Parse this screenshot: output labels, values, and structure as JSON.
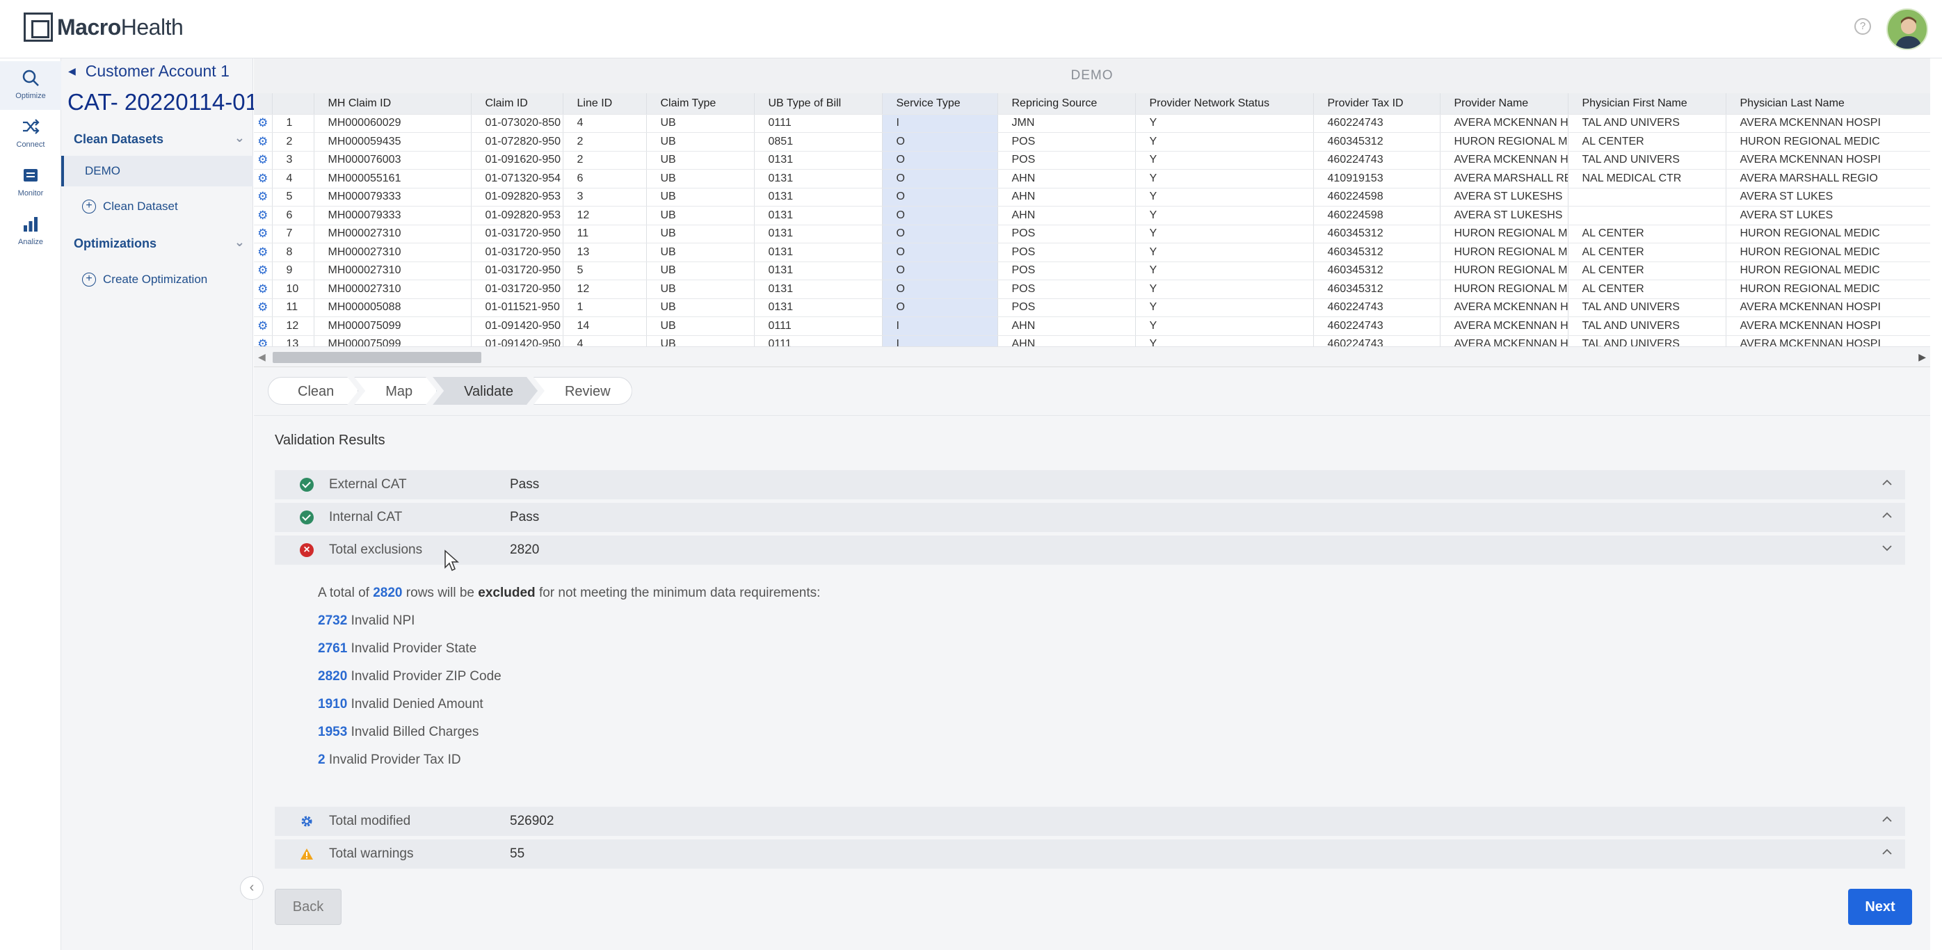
{
  "header": {
    "logo_bold": "Macro",
    "logo_rest": "Health",
    "help_icon": "?"
  },
  "rail": [
    {
      "label": "Optimize",
      "icon": "search-icon",
      "active": true
    },
    {
      "label": "Connect",
      "icon": "shuffle-icon"
    },
    {
      "label": "Monitor",
      "icon": "list-icon"
    },
    {
      "label": "Analize",
      "icon": "bar-chart-icon"
    }
  ],
  "left_panel": {
    "account": "Customer Account 1",
    "cat_title": "CAT- 20220114-01",
    "clean_datasets": "Clean Datasets",
    "demo_item": "DEMO",
    "add_clean_dataset": "Clean Dataset",
    "optimizations": "Optimizations",
    "add_optimization": "Create Optimization"
  },
  "grid": {
    "caption": "DEMO",
    "columns": [
      "MH Claim ID",
      "Claim ID",
      "Line ID",
      "Claim Type",
      "UB Type of Bill",
      "Service Type",
      "Repricing Source",
      "Provider Network Status",
      "Provider Tax ID",
      "Provider Name",
      "Physician First Name",
      "Physician Last Name"
    ],
    "rows": [
      [
        "1",
        "MH000060029",
        "01-073020-850",
        "4",
        "UB",
        "0111",
        "I",
        "JMN",
        "Y",
        "460224743",
        "AVERA MCKENNAN HO",
        "TAL AND UNIVERS",
        "AVERA MCKENNAN HOSPI"
      ],
      [
        "2",
        "MH000059435",
        "01-072820-950",
        "2",
        "UB",
        "0851",
        "O",
        "POS",
        "Y",
        "460345312",
        "HURON REGIONAL MI",
        "AL CENTER",
        "HURON REGIONAL MEDIC"
      ],
      [
        "3",
        "MH000076003",
        "01-091620-950",
        "2",
        "UB",
        "0131",
        "O",
        "POS",
        "Y",
        "460224743",
        "AVERA MCKENNAN HO",
        "TAL AND UNIVERS",
        "AVERA MCKENNAN HOSPI"
      ],
      [
        "4",
        "MH000055161",
        "01-071320-954",
        "6",
        "UB",
        "0131",
        "O",
        "AHN",
        "Y",
        "410919153",
        "AVERA MARSHALL RE",
        "NAL MEDICAL CTR",
        "AVERA MARSHALL REGIO"
      ],
      [
        "5",
        "MH000079333",
        "01-092820-953",
        "3",
        "UB",
        "0131",
        "O",
        "AHN",
        "Y",
        "460224598",
        "AVERA ST LUKESHS",
        "",
        "AVERA ST LUKES"
      ],
      [
        "6",
        "MH000079333",
        "01-092820-953",
        "12",
        "UB",
        "0131",
        "O",
        "AHN",
        "Y",
        "460224598",
        "AVERA ST LUKESHS",
        "",
        "AVERA ST LUKES"
      ],
      [
        "7",
        "MH000027310",
        "01-031720-950",
        "11",
        "UB",
        "0131",
        "O",
        "POS",
        "Y",
        "460345312",
        "HURON REGIONAL MI",
        "AL CENTER",
        "HURON REGIONAL MEDIC"
      ],
      [
        "8",
        "MH000027310",
        "01-031720-950",
        "13",
        "UB",
        "0131",
        "O",
        "POS",
        "Y",
        "460345312",
        "HURON REGIONAL MI",
        "AL CENTER",
        "HURON REGIONAL MEDIC"
      ],
      [
        "9",
        "MH000027310",
        "01-031720-950",
        "5",
        "UB",
        "0131",
        "O",
        "POS",
        "Y",
        "460345312",
        "HURON REGIONAL MI",
        "AL CENTER",
        "HURON REGIONAL MEDIC"
      ],
      [
        "10",
        "MH000027310",
        "01-031720-950",
        "12",
        "UB",
        "0131",
        "O",
        "POS",
        "Y",
        "460345312",
        "HURON REGIONAL MI",
        "AL CENTER",
        "HURON REGIONAL MEDIC"
      ],
      [
        "11",
        "MH000005088",
        "01-011521-950",
        "1",
        "UB",
        "0131",
        "O",
        "POS",
        "Y",
        "460224743",
        "AVERA MCKENNAN HO",
        "TAL AND UNIVERS",
        "AVERA MCKENNAN HOSPI"
      ],
      [
        "12",
        "MH000075099",
        "01-091420-950",
        "14",
        "UB",
        "0111",
        "I",
        "AHN",
        "Y",
        "460224743",
        "AVERA MCKENNAN HO",
        "TAL AND UNIVERS",
        "AVERA MCKENNAN HOSPI"
      ],
      [
        "13",
        "MH000075099",
        "01-091420-950",
        "4",
        "UB",
        "0111",
        "I",
        "AHN",
        "Y",
        "460224743",
        "AVERA MCKENNAN HO",
        "TAL AND UNIVERS",
        "AVERA MCKENNAN HOSPI"
      ]
    ]
  },
  "steps": [
    "Clean",
    "Map",
    "Validate",
    "Review"
  ],
  "active_step": "Validate",
  "validation": {
    "title": "Validation Results",
    "rows": [
      {
        "name": "External CAT",
        "value": "Pass",
        "status": "ok"
      },
      {
        "name": "Internal CAT",
        "value": "Pass",
        "status": "ok"
      },
      {
        "name": "Total exclusions",
        "value": "2820",
        "status": "error"
      },
      {
        "name": "Total modified",
        "value": "526902",
        "status": "modified"
      },
      {
        "name": "Total warnings",
        "value": "55",
        "status": "warning"
      }
    ],
    "summary": {
      "pre": "A total of",
      "count": "2820",
      "mid": "rows will be",
      "bold": "excluded",
      "post": "for not meeting the minimum data requirements:"
    },
    "details": [
      {
        "count": "2732",
        "label": "Invalid NPI"
      },
      {
        "count": "2761",
        "label": "Invalid Provider State"
      },
      {
        "count": "2820",
        "label": "Invalid Provider ZIP Code"
      },
      {
        "count": "1910",
        "label": "Invalid Denied Amount"
      },
      {
        "count": "1953",
        "label": "Invalid Billed Charges"
      },
      {
        "count": "2",
        "label": "Invalid Provider Tax ID"
      }
    ]
  },
  "buttons": {
    "back": "Back",
    "next": "Next"
  },
  "colors": {
    "primary": "#1f66de",
    "brand_navy": "#1f4e8c",
    "pass": "#2e8b62",
    "error": "#d02b2b",
    "warning": "#f2a41a"
  }
}
